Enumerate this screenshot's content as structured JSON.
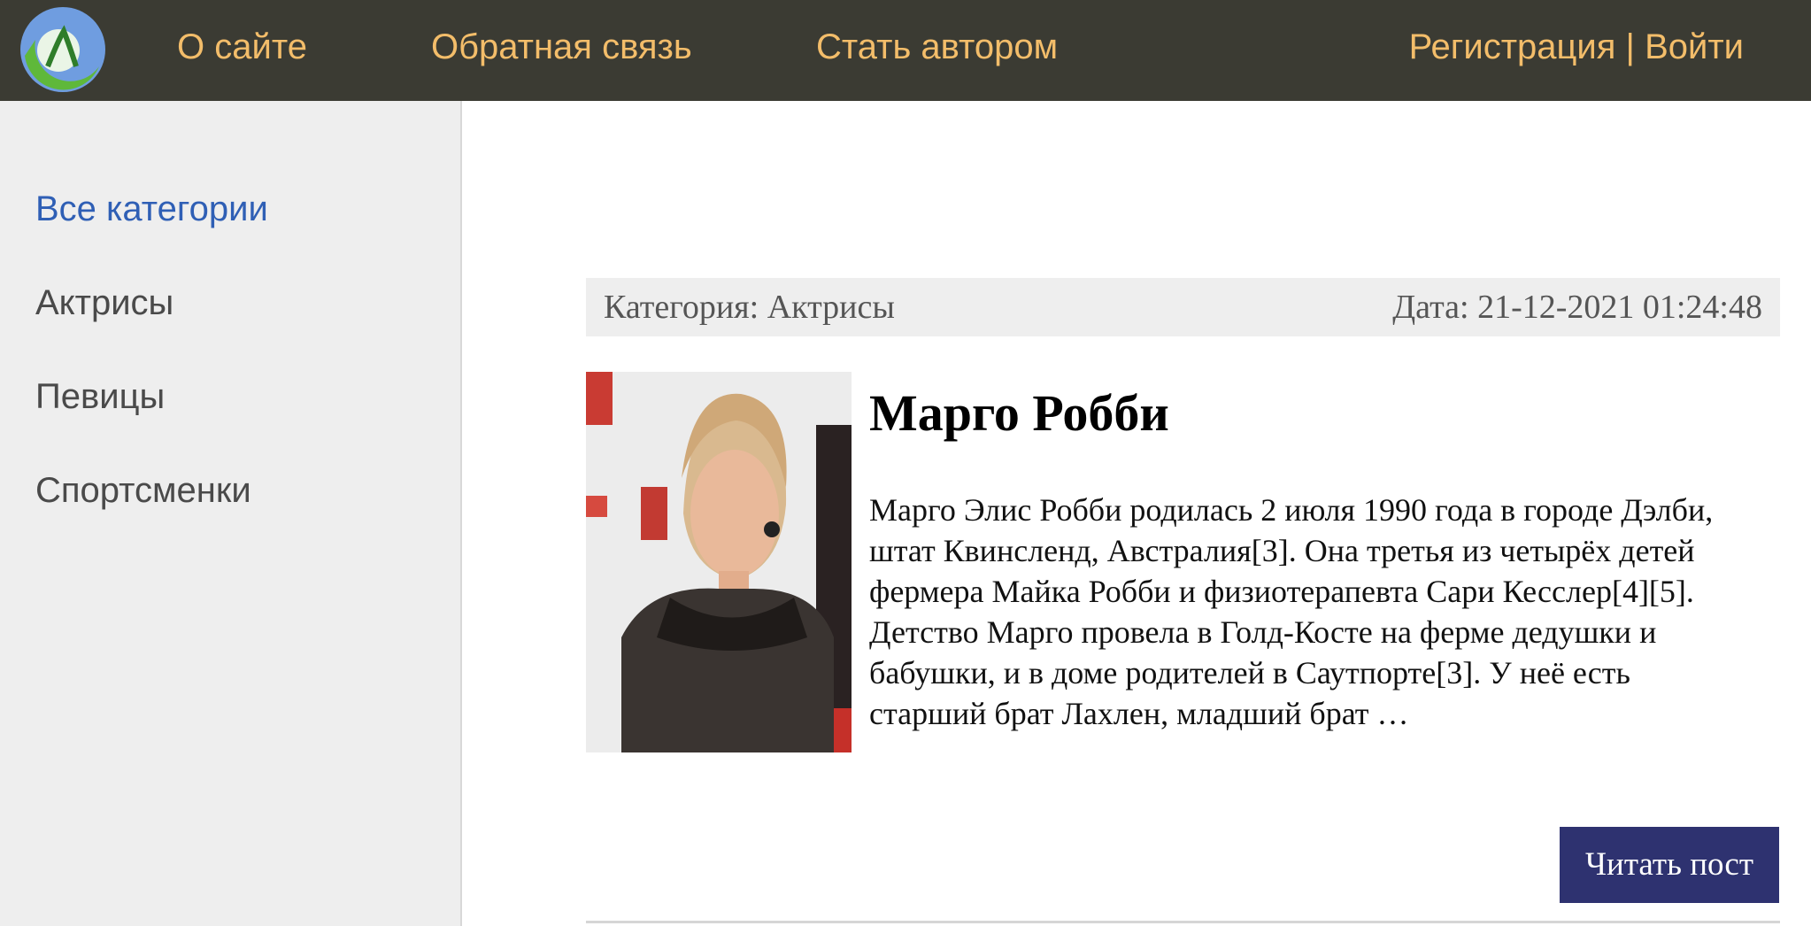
{
  "nav": {
    "about": "О сайте",
    "feedback": "Обратная связь",
    "become_author": "Стать автором",
    "register": "Регистрация",
    "separator": " | ",
    "login": "Войти"
  },
  "sidebar": {
    "items": [
      {
        "label": "Все категории"
      },
      {
        "label": "Актрисы"
      },
      {
        "label": "Певицы"
      },
      {
        "label": "Спортсменки"
      }
    ]
  },
  "post": {
    "category": "Категория: Актрисы",
    "date": "Дата: 21-12-2021 01:24:48",
    "title": "Марго Робби",
    "excerpt": "Марго Элис Робби родилась 2 июля 1990 года в городе Дэлби, штат Квинсленд, Австралия[3]. Она третья из четырёх детей фермера Майка Робби и физиотерапевта Сари Кесслер[4][5]. Детство Марго провела в Голд-Косте на ферме дедушки и бабушки, и в доме родителей в Саутпорте[3]. У неё есть старший брат Лахлен, младший брат …",
    "read_button": "Читать пост"
  },
  "colors": {
    "topbar": "#3b3b33",
    "nav_text": "#f3bd6a",
    "sidebar_bg": "#eeeeee",
    "active_link": "#2f5fb5",
    "button_bg": "#2e3270"
  },
  "icons": {
    "logo": "site-logo-icon"
  }
}
